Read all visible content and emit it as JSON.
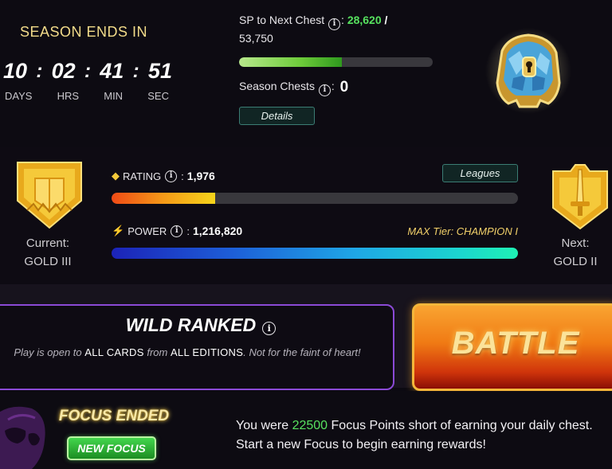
{
  "season": {
    "title": "SEASON ENDS IN",
    "days": "10",
    "hrs": "02",
    "min": "41",
    "sec": "51",
    "labels": {
      "days": "DAYS",
      "hrs": "HRS",
      "min": "MIN",
      "sec": "SEC"
    }
  },
  "sp": {
    "label": "SP to Next Chest",
    "colon": ":",
    "current": "28,620",
    "slash": " /",
    "target": "53,750",
    "progress_fraction": 0.532,
    "season_chests_label": "Season Chests",
    "season_chests_value": "0",
    "details_label": "Details"
  },
  "league": {
    "current_label": "Current:",
    "current_name": "GOLD III",
    "next_label": "Next:",
    "next_name": "GOLD II",
    "rating_label": "RATING",
    "rating_value": "1,976",
    "rating_progress_fraction": 0.255,
    "leagues_button": "Leagues",
    "power_label": "POWER",
    "power_value": "1,216,820",
    "power_progress_fraction": 1.0,
    "max_tier": "MAX Tier: CHAMPION I"
  },
  "mode": {
    "title": "WILD RANKED",
    "desc_prefix": "Play is open to ",
    "desc_all_cards": "ALL CARDS",
    "desc_from": " from ",
    "desc_all_editions": "ALL EDITIONS",
    "desc_suffix": ". Not for the faint of heart!"
  },
  "battle": {
    "label": "BATTLE"
  },
  "focus": {
    "status": "FOCUS ENDED",
    "new_focus_label": "NEW FOCUS",
    "msg_prefix": "You were ",
    "msg_points": "22500",
    "msg_suffix": " Focus Points short of earning your daily chest. Start a new Focus to begin earning rewards!"
  },
  "colors": {
    "accent_gold": "#f3dc8a",
    "sp_green": "#57e25f",
    "mode_border": "#8b4ad6",
    "battle_orange": "#f07a14"
  },
  "icons": {
    "info": "info-icon",
    "rating": "rating-shield-icon",
    "power": "lightning-icon",
    "chest": "season-chest-icon",
    "current_badge": "gold-league-badge-icon",
    "next_badge": "gold-league-badge-icon",
    "skull": "focus-skull-icon"
  }
}
